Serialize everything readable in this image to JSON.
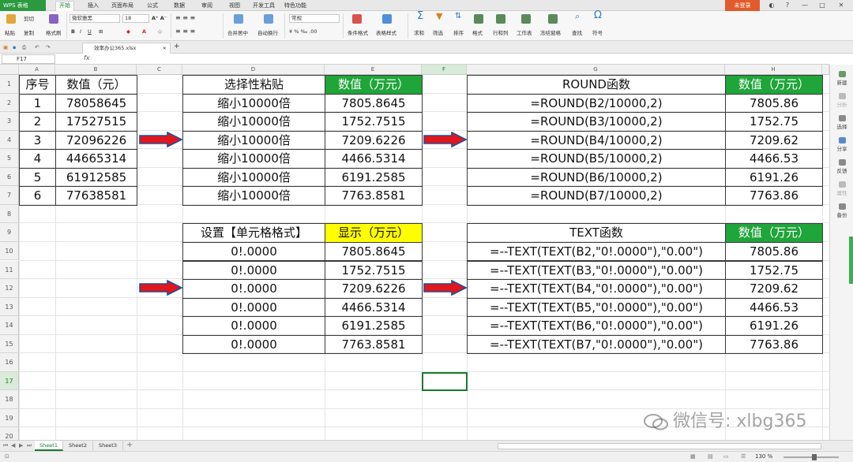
{
  "app": {
    "badge": "WPS 表格",
    "menus": [
      "开始",
      "插入",
      "页面布局",
      "公式",
      "数据",
      "审阅",
      "视图",
      "开发工具",
      "特色功能"
    ],
    "login": "未登录"
  },
  "ribbon": {
    "paste": "粘贴",
    "cut": "剪切",
    "copy": "复制",
    "format_painter": "格式刷",
    "font_name": "微软雅黑",
    "font_size": "18",
    "number_format": "常规",
    "merge_center": "合并居中",
    "wrap": "自动换行",
    "cond_format": "条件格式",
    "table_style": "表格样式",
    "sum": "求和",
    "filter": "筛选",
    "sort": "排序",
    "format": "格式",
    "rows_cols": "行和列",
    "sheet": "工作表",
    "freeze": "冻结窗格",
    "find": "查找",
    "symbol": "符号"
  },
  "tabs": {
    "doc": "效率办公365.xlsx"
  },
  "formula": {
    "namebox": "F17",
    "fx": "fx"
  },
  "grid": {
    "columns": [
      "A",
      "B",
      "C",
      "D",
      "E",
      "F",
      "G",
      "H"
    ],
    "rows": [
      "1",
      "2",
      "3",
      "4",
      "5",
      "6",
      "7",
      "8",
      "9",
      "10",
      "11",
      "12",
      "13",
      "14",
      "15",
      "16",
      "17",
      "18",
      "19",
      "20"
    ],
    "left_table": {
      "header": [
        "序号",
        "数值（元）"
      ],
      "rows": [
        [
          "1",
          "78058645"
        ],
        [
          "2",
          "17527515"
        ],
        [
          "3",
          "72096226"
        ],
        [
          "4",
          "44665314"
        ],
        [
          "5",
          "61912585"
        ],
        [
          "6",
          "77638581"
        ]
      ]
    },
    "paste_table": {
      "header": [
        "选择性粘贴",
        "数值（万元）"
      ],
      "rows": [
        [
          "缩小10000倍",
          "7805.8645"
        ],
        [
          "缩小10000倍",
          "1752.7515"
        ],
        [
          "缩小10000倍",
          "7209.6226"
        ],
        [
          "缩小10000倍",
          "4466.5314"
        ],
        [
          "缩小10000倍",
          "6191.2585"
        ],
        [
          "缩小10000倍",
          "7763.8581"
        ]
      ]
    },
    "round_table": {
      "header": [
        "ROUND函数",
        "数值（万元）"
      ],
      "rows": [
        [
          "=ROUND(B2/10000,2)",
          "7805.86"
        ],
        [
          "=ROUND(B3/10000,2)",
          "1752.75"
        ],
        [
          "=ROUND(B4/10000,2)",
          "7209.62"
        ],
        [
          "=ROUND(B5/10000,2)",
          "4466.53"
        ],
        [
          "=ROUND(B6/10000,2)",
          "6191.26"
        ],
        [
          "=ROUND(B7/10000,2)",
          "7763.86"
        ]
      ]
    },
    "format_table": {
      "header": [
        "设置【单元格格式】",
        "显示（万元）"
      ],
      "rows": [
        [
          "0!.0000",
          "7805.8645"
        ],
        [
          "0!.0000",
          "1752.7515"
        ],
        [
          "0!.0000",
          "7209.6226"
        ],
        [
          "0!.0000",
          "4466.5314"
        ],
        [
          "0!.0000",
          "6191.2585"
        ],
        [
          "0!.0000",
          "7763.8581"
        ]
      ]
    },
    "text_table": {
      "header": [
        "TEXT函数",
        "数值（万元）"
      ],
      "rows": [
        [
          "=--TEXT(TEXT(B2,\"0!.0000\"),\"0.00\")",
          "7805.86"
        ],
        [
          "=--TEXT(TEXT(B3,\"0!.0000\"),\"0.00\")",
          "1752.75"
        ],
        [
          "=--TEXT(TEXT(B4,\"0!.0000\"),\"0.00\")",
          "7209.62"
        ],
        [
          "=--TEXT(TEXT(B5,\"0!.0000\"),\"0.00\")",
          "4466.53"
        ],
        [
          "=--TEXT(TEXT(B6,\"0!.0000\"),\"0.00\")",
          "6191.26"
        ],
        [
          "=--TEXT(TEXT(B7,\"0!.0000\"),\"0.00\")",
          "7763.86"
        ]
      ]
    }
  },
  "right_panel": [
    "新建",
    "分析",
    "选择",
    "分享",
    "反馈",
    "属性",
    "备份"
  ],
  "sheets": [
    "Sheet1",
    "Sheet2",
    "Sheet3"
  ],
  "status": {
    "zoom": "130 %"
  },
  "watermark": "微信号: xlbg365",
  "colors": {
    "green": "#1fa53a",
    "yellow": "#ffff00",
    "arrow_red": "#e3161a",
    "arrow_blue": "#1f4e9c"
  }
}
